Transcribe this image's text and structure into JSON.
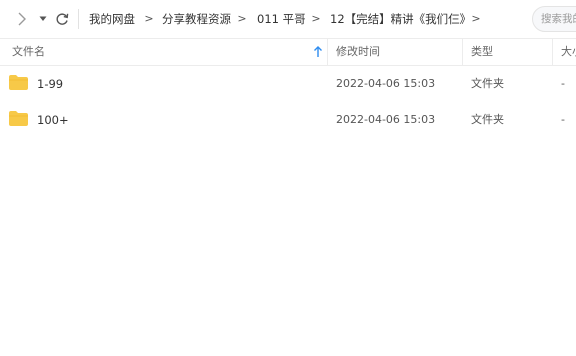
{
  "breadcrumb": {
    "items": [
      "我的网盘",
      "分享教程资源",
      "011 平哥",
      "12【完结】精讲《我们仨》"
    ],
    "separator": ">"
  },
  "search": {
    "placeholder": "搜索我的网盘文件"
  },
  "columns": {
    "name": "文件名",
    "modified": "修改时间",
    "type": "类型",
    "size": "大小"
  },
  "files": [
    {
      "name": "1-99",
      "modified": "2022-04-06 15:03",
      "type": "文件夹",
      "size": "-"
    },
    {
      "name": "100+",
      "modified": "2022-04-06 15:03",
      "type": "文件夹",
      "size": "-"
    }
  ],
  "icons": {
    "forward": "chevron-right-icon",
    "history": "caret-down-icon",
    "refresh": "refresh-icon",
    "folder": "folder-icon",
    "sort": "arrow-up-icon"
  },
  "colors": {
    "folder": "#F7C948",
    "sort_arrow": "#2D8CF0",
    "text": "#333333",
    "muted": "#666666",
    "border": "#ECECEC"
  }
}
